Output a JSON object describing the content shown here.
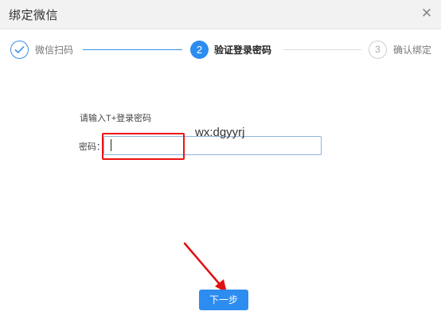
{
  "dialog": {
    "title": "绑定微信",
    "close_icon": "close-icon"
  },
  "stepper": {
    "steps": [
      {
        "number": "1",
        "label": "微信扫码",
        "state": "completed",
        "icon": "check-icon"
      },
      {
        "number": "2",
        "label": "验证登录密码",
        "state": "active"
      },
      {
        "number": "3",
        "label": "确认绑定",
        "state": "pending"
      }
    ]
  },
  "form": {
    "prompt": "请输入T+登录密码",
    "password_label": "密码：",
    "password_value": ""
  },
  "watermark": "wx:dgyyrj",
  "annotations": {
    "highlight_color": "#e11111",
    "arrow_color": "#e11111"
  },
  "actions": {
    "next_label": "下一步"
  },
  "colors": {
    "accent": "#2d8cf0",
    "header_bg": "#f2f2f2"
  }
}
